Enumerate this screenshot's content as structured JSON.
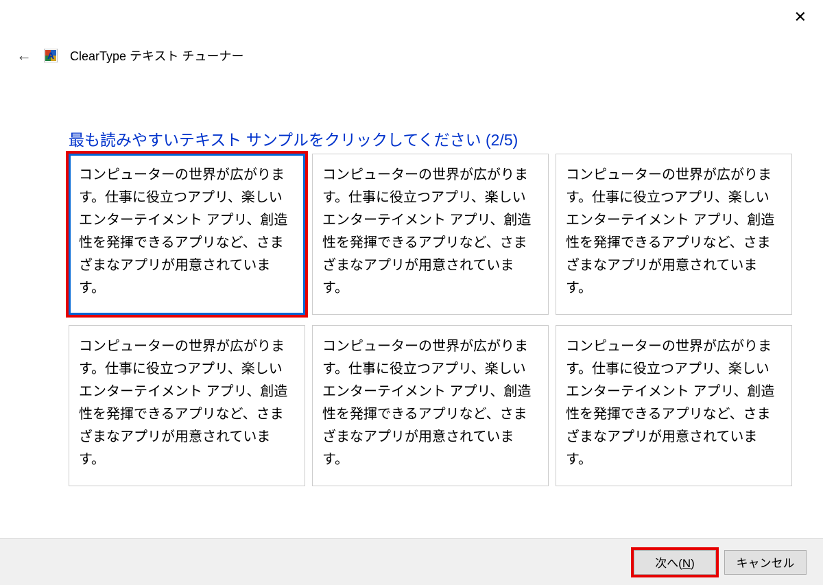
{
  "window": {
    "title": "ClearType テキスト チューナー"
  },
  "instruction": "最も読みやすいテキスト サンプルをクリックしてください (2/5)",
  "sample_text": "コンピューターの世界が広がります。仕事に役立つアプリ、楽しいエンターテイメント アプリ、創造性を発揮できるアプリなど、さまざまなアプリが用意されています。",
  "samples": [
    {
      "selected": true
    },
    {
      "selected": false
    },
    {
      "selected": false
    },
    {
      "selected": false
    },
    {
      "selected": false
    },
    {
      "selected": false
    }
  ],
  "buttons": {
    "next_prefix": "次へ(",
    "next_key": "N",
    "next_suffix": ")",
    "cancel": "キャンセル"
  }
}
